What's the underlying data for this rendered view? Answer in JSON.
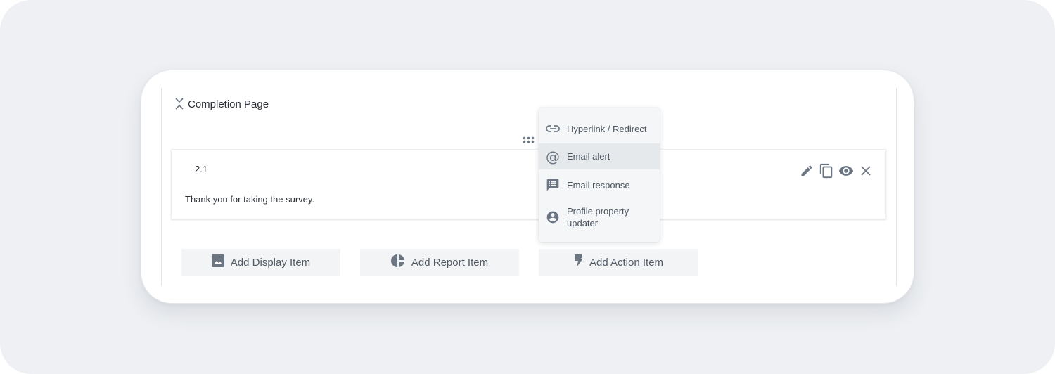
{
  "section": {
    "title": "Completion Page",
    "collapse_icon": "collapse-chevrons-icon"
  },
  "item": {
    "number": "2.1",
    "text": "Thank you for taking the survey.",
    "actions": [
      {
        "name": "edit",
        "icon": "pencil-icon"
      },
      {
        "name": "duplicate",
        "icon": "copy-icon"
      },
      {
        "name": "preview",
        "icon": "eye-icon"
      },
      {
        "name": "delete",
        "icon": "close-icon"
      }
    ]
  },
  "add_buttons": {
    "display": {
      "label": "Add Display Item",
      "icon": "image-icon"
    },
    "report": {
      "label": "Add Report Item",
      "icon": "pie-chart-icon"
    },
    "action": {
      "label": "Add Action Item",
      "icon": "lightning-icon"
    }
  },
  "action_menu": {
    "items": [
      {
        "label": "Hyperlink / Redirect",
        "icon": "link-icon",
        "highlighted": false
      },
      {
        "label": "Email alert",
        "icon": "at-sign-icon",
        "highlighted": true
      },
      {
        "label": "Email response",
        "icon": "message-list-icon",
        "highlighted": false
      },
      {
        "label": "Profile property updater",
        "icon": "account-circle-icon",
        "highlighted": false
      }
    ]
  },
  "colors": {
    "icon": "#6b7682",
    "text": "#2c3138",
    "button_bg": "#f2f4f6",
    "menu_bg": "#f4f6f8",
    "menu_highlight": "#e6e9ec"
  }
}
